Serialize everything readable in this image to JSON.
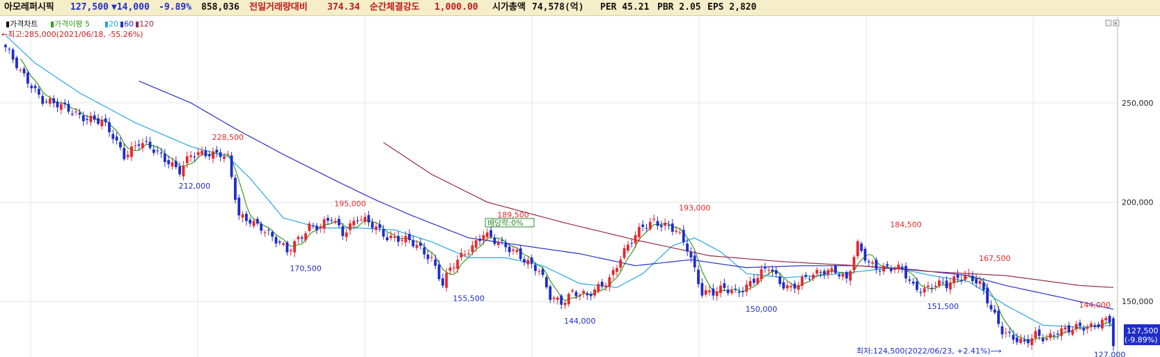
{
  "header": {
    "name": "아모레퍼시픽",
    "price": "127,500",
    "change": "▼14,000",
    "change_pct": "-9.89%",
    "volume": "858,036",
    "prev_vol_label": "전일거래량대비",
    "prev_vol_value": "374.34",
    "strength_label": "순간체결강도",
    "strength_value": "1,000.00",
    "mcap_label": "시가총액",
    "mcap_value": "74,578(억)",
    "per": "PER 45.21",
    "pbr": "PBR 2.05",
    "eps": "EPS 2,820"
  },
  "legend": {
    "price_chart": "가격차트",
    "ma_label": "가격이평 5",
    "ma20": "20",
    "ma60": "60",
    "ma120": "120"
  },
  "notes": {
    "high": "←최고:285,000(2021/06/18, -55.26%)",
    "low": "최저:124,500(2022/06/23, +2.41%)⟶",
    "marker": "배당락:0%"
  },
  "last_badge": {
    "price": "127,500",
    "pct": "(-9.89%)"
  },
  "colors": {
    "up": "#e8262a",
    "down": "#1e2ccc",
    "ma5": "#3a9a1c",
    "ma20": "#25a6e0",
    "ma60": "#2a2ec8",
    "ma120": "#962a44",
    "header_bg": "#f6eec8",
    "price_badge": "#1e2ccc"
  },
  "chart_data": {
    "type": "candlestick",
    "ylim": [
      122000,
      292000
    ],
    "yticks": [
      "250,000",
      "200,000",
      "150,000"
    ],
    "ytick_values": [
      250000,
      200000,
      150000
    ],
    "legend_position": "top-left",
    "grid": true,
    "anchors": [
      [
        0,
        278000
      ],
      [
        4,
        265000
      ],
      [
        7,
        259000
      ],
      [
        10,
        252000
      ],
      [
        16,
        247000
      ],
      [
        20,
        244000
      ],
      [
        23,
        242000
      ],
      [
        26,
        240000
      ],
      [
        29,
        233000
      ],
      [
        32,
        224000
      ],
      [
        36,
        230000
      ],
      [
        39,
        227000
      ],
      [
        44,
        221000
      ],
      [
        47,
        216000
      ],
      [
        50,
        223000
      ],
      [
        55,
        225000
      ],
      [
        58,
        225000
      ],
      [
        60,
        222000
      ],
      [
        61,
        212000
      ],
      [
        63,
        192000
      ],
      [
        66,
        191000
      ],
      [
        69,
        188000
      ],
      [
        72,
        182000
      ],
      [
        76,
        175000
      ],
      [
        79,
        182000
      ],
      [
        82,
        188000
      ],
      [
        85,
        187000
      ],
      [
        88,
        192000
      ],
      [
        91,
        185000
      ],
      [
        95,
        192000
      ],
      [
        99,
        188000
      ],
      [
        103,
        183000
      ],
      [
        106,
        182000
      ],
      [
        109,
        180000
      ],
      [
        112,
        176000
      ],
      [
        115,
        172000
      ],
      [
        118,
        159000
      ],
      [
        120,
        166000
      ],
      [
        123,
        172000
      ],
      [
        126,
        178000
      ],
      [
        129,
        185000
      ],
      [
        132,
        180000
      ],
      [
        135,
        177000
      ],
      [
        138,
        175000
      ],
      [
        141,
        170000
      ],
      [
        144,
        165000
      ],
      [
        147,
        152000
      ],
      [
        150,
        150000
      ],
      [
        153,
        155000
      ],
      [
        157,
        152000
      ],
      [
        160,
        157000
      ],
      [
        163,
        162000
      ],
      [
        166,
        172000
      ],
      [
        169,
        180000
      ],
      [
        172,
        188000
      ],
      [
        175,
        191000
      ],
      [
        178,
        188000
      ],
      [
        181,
        185000
      ],
      [
        184,
        177000
      ],
      [
        185,
        172000
      ],
      [
        188,
        155000
      ],
      [
        191,
        154000
      ],
      [
        194,
        156000
      ],
      [
        197,
        155000
      ],
      [
        200,
        158000
      ],
      [
        203,
        162000
      ],
      [
        206,
        167000
      ],
      [
        209,
        160000
      ],
      [
        212,
        157000
      ],
      [
        215,
        160000
      ],
      [
        218,
        163000
      ],
      [
        221,
        166000
      ],
      [
        224,
        166000
      ],
      [
        227,
        160000
      ],
      [
        230,
        178000
      ],
      [
        233,
        170000
      ],
      [
        236,
        167000
      ],
      [
        239,
        166000
      ],
      [
        242,
        166000
      ],
      [
        245,
        158000
      ],
      [
        248,
        156000
      ],
      [
        251,
        158000
      ],
      [
        254,
        158000
      ],
      [
        257,
        163000
      ],
      [
        260,
        163000
      ],
      [
        263,
        158000
      ],
      [
        266,
        146000
      ],
      [
        269,
        136000
      ],
      [
        272,
        132000
      ],
      [
        275,
        128000
      ],
      [
        278,
        133000
      ],
      [
        281,
        132000
      ],
      [
        284,
        135000
      ],
      [
        287,
        135000
      ],
      [
        290,
        137000
      ],
      [
        293,
        138000
      ],
      [
        296,
        140000
      ],
      [
        298,
        140000
      ],
      [
        299,
        127500
      ]
    ],
    "ma": [
      {
        "name": "20",
        "start": 0,
        "values": [
          [
            0,
            284000
          ],
          [
            8,
            270000
          ],
          [
            20,
            255000
          ],
          [
            35,
            240000
          ],
          [
            50,
            228000
          ],
          [
            60,
            223000
          ],
          [
            66,
            212000
          ],
          [
            75,
            192000
          ],
          [
            85,
            187000
          ],
          [
            95,
            187000
          ],
          [
            105,
            186000
          ],
          [
            115,
            180000
          ],
          [
            125,
            172000
          ],
          [
            135,
            172000
          ],
          [
            145,
            168000
          ],
          [
            155,
            159000
          ],
          [
            165,
            157000
          ],
          [
            172,
            164000
          ],
          [
            180,
            178000
          ],
          [
            186,
            182000
          ],
          [
            193,
            175000
          ],
          [
            200,
            164000
          ],
          [
            210,
            162000
          ],
          [
            220,
            163000
          ],
          [
            230,
            165000
          ],
          [
            240,
            167000
          ],
          [
            250,
            163000
          ],
          [
            260,
            160000
          ],
          [
            270,
            148000
          ],
          [
            280,
            138000
          ],
          [
            290,
            137000
          ],
          [
            299,
            138000
          ]
        ]
      },
      {
        "name": "60",
        "start": 36,
        "values": [
          [
            36,
            261000
          ],
          [
            50,
            250000
          ],
          [
            62,
            237000
          ],
          [
            75,
            224000
          ],
          [
            90,
            210000
          ],
          [
            100,
            201000
          ],
          [
            110,
            193000
          ],
          [
            125,
            182000
          ],
          [
            140,
            178000
          ],
          [
            155,
            174000
          ],
          [
            170,
            168000
          ],
          [
            185,
            171000
          ],
          [
            200,
            167000
          ],
          [
            215,
            168000
          ],
          [
            230,
            168000
          ],
          [
            245,
            166000
          ],
          [
            260,
            163000
          ],
          [
            270,
            158000
          ],
          [
            285,
            152000
          ],
          [
            299,
            146000
          ]
        ]
      },
      {
        "name": "120",
        "start": 102,
        "values": [
          [
            102,
            230000
          ],
          [
            115,
            214000
          ],
          [
            130,
            200000
          ],
          [
            150,
            190000
          ],
          [
            170,
            181000
          ],
          [
            190,
            173000
          ],
          [
            210,
            170000
          ],
          [
            230,
            168000
          ],
          [
            250,
            165000
          ],
          [
            270,
            163000
          ],
          [
            290,
            158000
          ],
          [
            299,
            157000
          ]
        ]
      }
    ],
    "annotations": [
      {
        "label": "228,500",
        "x": 60,
        "value": 228500,
        "kind": "high"
      },
      {
        "label": "212,000",
        "x": 51,
        "value": 212000,
        "kind": "low"
      },
      {
        "label": "195,000",
        "x": 93,
        "value": 195000,
        "kind": "high"
      },
      {
        "label": "170,500",
        "x": 81,
        "value": 170500,
        "kind": "low"
      },
      {
        "label": "189,500",
        "x": 137,
        "value": 189500,
        "kind": "high"
      },
      {
        "label": "155,500",
        "x": 125,
        "value": 155500,
        "kind": "low"
      },
      {
        "label": "144,000",
        "x": 155,
        "value": 144000,
        "kind": "low"
      },
      {
        "label": "193,000",
        "x": 186,
        "value": 193000,
        "kind": "high"
      },
      {
        "label": "150,000",
        "x": 204,
        "value": 150000,
        "kind": "low"
      },
      {
        "label": "184,500",
        "x": 243,
        "value": 184500,
        "kind": "high"
      },
      {
        "label": "151,500",
        "x": 253,
        "value": 151500,
        "kind": "low"
      },
      {
        "label": "167,500",
        "x": 267,
        "value": 167500,
        "kind": "high"
      },
      {
        "label": "124,500",
        "x": 282,
        "value": 124500,
        "kind": "low"
      },
      {
        "label": "144,000",
        "x": 294,
        "value": 144000,
        "kind": "high"
      },
      {
        "label": "127,000",
        "x": 298,
        "value": 127000,
        "kind": "low"
      }
    ]
  }
}
